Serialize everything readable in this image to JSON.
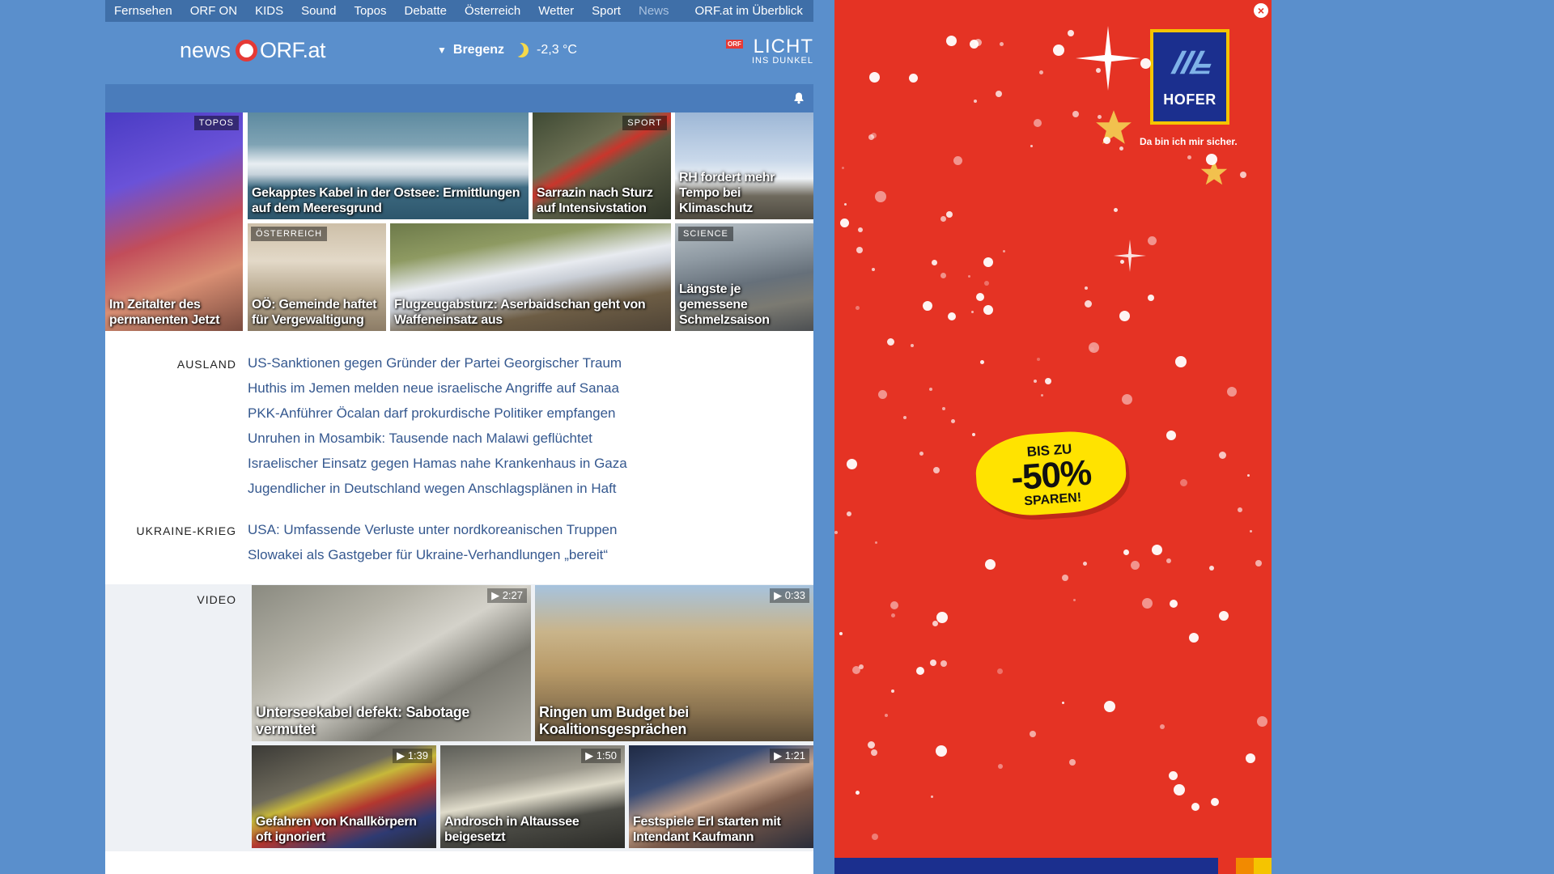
{
  "nav": {
    "items": [
      "Fernsehen",
      "ORF ON",
      "KIDS",
      "Sound",
      "Topos",
      "Debatte",
      "Österreich",
      "Wetter",
      "Sport",
      "News"
    ],
    "active": "News",
    "overview": "ORF.at im Überblick"
  },
  "header": {
    "logo_news": "news",
    "logo_orf": "ORF.at",
    "weather_location": "Bregenz",
    "weather_temp": "-2,3 °C",
    "litd_badge": "ORF",
    "litd_title": "LICHT",
    "litd_sub": "INS DUNKEL"
  },
  "tiles": [
    {
      "tag": "TOPOS",
      "title": "Im Zeitalter des permanenten Jetzt"
    },
    {
      "tag": "",
      "title": "Gekapptes Kabel in der Ostsee: Ermittlungen auf dem Meeresgrund"
    },
    {
      "tag": "SPORT",
      "title": "Sarrazin nach Sturz auf Intensivstation"
    },
    {
      "tag": "",
      "title": "RH fordert mehr Tempo bei Klimaschutz"
    },
    {
      "tag": "ÖSTERREICH",
      "title": "OÖ: Gemeinde haftet für Vergewaltigung"
    },
    {
      "tag": "",
      "title": "Flugzeugabsturz: Aserbaidschan geht von Waffeneinsatz aus"
    },
    {
      "tag": "SCIENCE",
      "title": "Längste je gemessene Schmelzsaison"
    }
  ],
  "sections": {
    "ausland": {
      "label": "AUSLAND",
      "items": [
        "US-Sanktionen gegen Gründer der Partei Georgischer Traum",
        "Huthis im Jemen melden neue israelische Angriffe auf Sanaa",
        "PKK-Anführer Öcalan darf prokurdische Politiker empfangen",
        "Unruhen in Mosambik: Tausende nach Malawi geflüchtet",
        "Israelischer Einsatz gegen Hamas nahe Krankenhaus in Gaza",
        "Jugendlicher in Deutschland wegen Anschlagsplänen in Haft"
      ]
    },
    "ukraine": {
      "label": "UKRAINE-KRIEG",
      "items": [
        "USA: Umfassende Verluste unter nordkoreanischen Truppen",
        "Slowakei als Gastgeber für Ukraine-Verhandlungen „bereit“"
      ]
    },
    "video": {
      "label": "VIDEO",
      "items": [
        {
          "duration": "2:27",
          "title": "Unterseekabel defekt: Sabotage vermutet"
        },
        {
          "duration": "0:33",
          "title": "Ringen um Budget bei Koalitionsgesprächen"
        },
        {
          "duration": "1:39",
          "title": "Gefahren von Knallkörpern oft ignoriert"
        },
        {
          "duration": "1:50",
          "title": "Androsch in Altaussee beigesetzt"
        },
        {
          "duration": "1:21",
          "title": "Festspiele Erl starten mit Intendant Kaufmann"
        }
      ]
    }
  },
  "ad": {
    "brand": "HOFER",
    "slogan": "Da bin ich mir sicher.",
    "badge_line1": "BIS ZU",
    "badge_line2": "-50%",
    "badge_line3": "SPAREN!",
    "close_icon": "close-icon"
  },
  "colors": {
    "page_bg": "#5a8fcc",
    "nav_bg": "#3f6fa8",
    "link": "#35588f",
    "ad_red": "#e53324",
    "ad_yellow": "#ffe300",
    "hofer_blue": "#1b2f8e"
  }
}
